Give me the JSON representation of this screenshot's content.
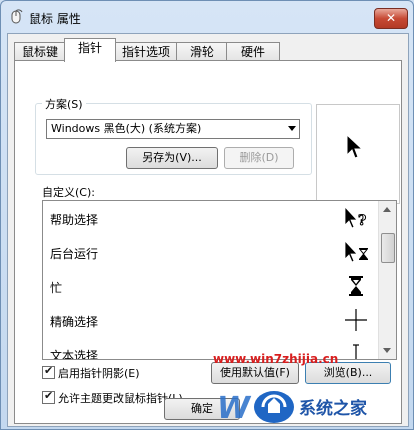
{
  "window": {
    "title": "鼠标 属性",
    "close_glyph": "✕"
  },
  "tabs": [
    {
      "label": "鼠标键",
      "active": false
    },
    {
      "label": "指针",
      "active": true
    },
    {
      "label": "指针选项",
      "active": false
    },
    {
      "label": "滑轮",
      "active": false
    },
    {
      "label": "硬件",
      "active": false
    }
  ],
  "scheme": {
    "label": "方案(S)",
    "selected": "Windows 黑色(大) (系统方案)",
    "save_as": "另存为(V)...",
    "delete": "删除(D)"
  },
  "customize": {
    "label": "自定义(C):",
    "items": [
      {
        "label": "帮助选择",
        "icon": "help-select-cursor-icon"
      },
      {
        "label": "后台运行",
        "icon": "working-in-background-cursor-icon"
      },
      {
        "label": "忙",
        "icon": "busy-hourglass-cursor-icon"
      },
      {
        "label": "精确选择",
        "icon": "precision-crosshair-cursor-icon"
      },
      {
        "label": "文本选择",
        "icon": "text-select-cursor-icon"
      }
    ]
  },
  "options": {
    "shadow_label": "启用指针阴影(E)",
    "shadow_checked": true,
    "theme_label": "允许主题更改鼠标指针(L)",
    "theme_checked": true
  },
  "buttons": {
    "use_default": "使用默认值(F)",
    "browse": "浏览(B)...",
    "ok": "确定"
  },
  "watermark": {
    "url": "www.win7zhijia.cn",
    "brand": "系统之家"
  },
  "colors": {
    "accent_red": "#d81e1e",
    "close_red": "#c74a35",
    "title_bg": "#c3d8ef"
  }
}
